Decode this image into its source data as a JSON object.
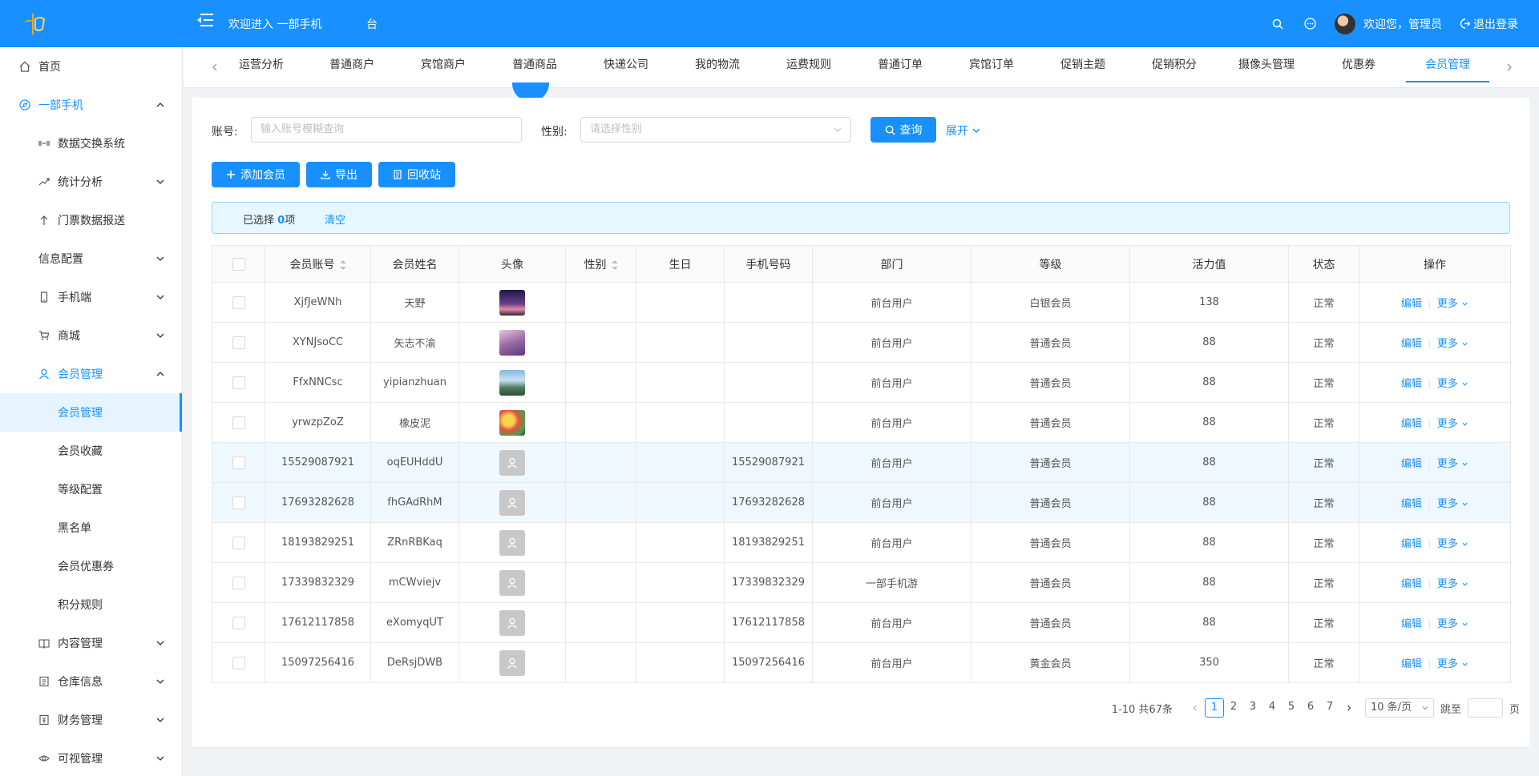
{
  "header": {
    "welcome": "欢迎进入 一部手机",
    "welcome_suffix": "台",
    "user": "欢迎您，管理员",
    "logout": "退出登录"
  },
  "sidebar": {
    "items": [
      {
        "label": "首页",
        "icon": "home-icon"
      },
      {
        "label": "一部手机",
        "icon": "compass-icon"
      },
      {
        "label": "数据交换系统",
        "icon": "exchange-icon"
      },
      {
        "label": "统计分析",
        "icon": "trend-icon"
      },
      {
        "label": "门票数据报送",
        "icon": "arrow-up-icon"
      },
      {
        "label": "信息配置",
        "icon": ""
      },
      {
        "label": "手机端",
        "icon": "mobile-icon"
      },
      {
        "label": "商城",
        "icon": "cart-icon"
      },
      {
        "label": "会员管理",
        "icon": "user-icon"
      },
      {
        "label": "会员管理",
        "icon": ""
      },
      {
        "label": "会员收藏",
        "icon": ""
      },
      {
        "label": "等级配置",
        "icon": ""
      },
      {
        "label": "黑名单",
        "icon": ""
      },
      {
        "label": "会员优惠券",
        "icon": ""
      },
      {
        "label": "积分规则",
        "icon": ""
      },
      {
        "label": "内容管理",
        "icon": "book-icon"
      },
      {
        "label": "仓库信息",
        "icon": "list-icon"
      },
      {
        "label": "财务管理",
        "icon": "finance-icon"
      },
      {
        "label": "可视管理",
        "icon": "eye-icon"
      }
    ]
  },
  "tabs": [
    "运营分析",
    "普通商户",
    "宾馆商户",
    "普通商品",
    "快递公司",
    "我的物流",
    "运费规则",
    "普通订单",
    "宾馆订单",
    "促销主题",
    "促销积分",
    "摄像头管理",
    "优惠券",
    "会员管理"
  ],
  "search": {
    "account_label": "账号:",
    "account_placeholder": "输入账号模糊查询",
    "gender_label": "性别:",
    "gender_placeholder": "请选择性别",
    "query_button": "查询",
    "expand": "展开"
  },
  "actions": {
    "add": "添加会员",
    "export": "导出",
    "recycle": "回收站"
  },
  "alert": {
    "prefix": "已选择 ",
    "count": "0",
    "suffix": "项",
    "clear": "清空"
  },
  "table": {
    "headers": [
      "会员账号",
      "会员姓名",
      "头像",
      "性别",
      "生日",
      "手机号码",
      "部门",
      "等级",
      "活力值",
      "状态",
      "操作"
    ],
    "edit_label": "编辑",
    "more_label": "更多",
    "rows": [
      {
        "account": "XjfJeWNh",
        "name": "天野",
        "avatar": "photo-night",
        "gender": "",
        "birthday": "",
        "phone": "",
        "dept": "前台用户",
        "level": "白银会员",
        "vitality": "138",
        "status": "正常"
      },
      {
        "account": "XYNJsoCC",
        "name": "矢志不渝",
        "avatar": "photo-purple",
        "gender": "",
        "birthday": "",
        "phone": "",
        "dept": "前台用户",
        "level": "普通会员",
        "vitality": "88",
        "status": "正常"
      },
      {
        "account": "FfxNNCsc",
        "name": "yipianzhuan",
        "avatar": "photo-building",
        "gender": "",
        "birthday": "",
        "phone": "",
        "dept": "前台用户",
        "level": "普通会员",
        "vitality": "88",
        "status": "正常"
      },
      {
        "account": "yrwzpZoZ",
        "name": "橡皮泥",
        "avatar": "photo-colorful",
        "gender": "",
        "birthday": "",
        "phone": "",
        "dept": "前台用户",
        "level": "普通会员",
        "vitality": "88",
        "status": "正常"
      },
      {
        "account": "15529087921",
        "name": "oqEUHddU",
        "avatar": "placeholder",
        "gender": "",
        "birthday": "",
        "phone": "15529087921",
        "dept": "前台用户",
        "level": "普通会员",
        "vitality": "88",
        "status": "正常"
      },
      {
        "account": "17693282628",
        "name": "fhGAdRhM",
        "avatar": "placeholder",
        "gender": "",
        "birthday": "",
        "phone": "17693282628",
        "dept": "前台用户",
        "level": "普通会员",
        "vitality": "88",
        "status": "正常"
      },
      {
        "account": "18193829251",
        "name": "ZRnRBKaq",
        "avatar": "placeholder",
        "gender": "",
        "birthday": "",
        "phone": "18193829251",
        "dept": "前台用户",
        "level": "普通会员",
        "vitality": "88",
        "status": "正常"
      },
      {
        "account": "17339832329",
        "name": "mCWviejv",
        "avatar": "placeholder",
        "gender": "",
        "birthday": "",
        "phone": "17339832329",
        "dept": "一部手机游",
        "level": "普通会员",
        "vitality": "88",
        "status": "正常"
      },
      {
        "account": "17612117858",
        "name": "eXomyqUT",
        "avatar": "placeholder",
        "gender": "",
        "birthday": "",
        "phone": "17612117858",
        "dept": "前台用户",
        "level": "普通会员",
        "vitality": "88",
        "status": "正常"
      },
      {
        "account": "15097256416",
        "name": "DeRsjDWB",
        "avatar": "placeholder",
        "gender": "",
        "birthday": "",
        "phone": "15097256416",
        "dept": "前台用户",
        "level": "黄金会员",
        "vitality": "350",
        "status": "正常"
      }
    ]
  },
  "pagination": {
    "total": "1-10 共67条",
    "pages": [
      "1",
      "2",
      "3",
      "4",
      "5",
      "6",
      "7"
    ],
    "current": "1",
    "page_size": "10 条/页",
    "jump_label": "跳至",
    "page_suffix": "页"
  },
  "colors": {
    "primary": "#1890ff",
    "sidebar_selected_bg": "#e6f4ff",
    "alert_bg": "#e6f7ff"
  }
}
